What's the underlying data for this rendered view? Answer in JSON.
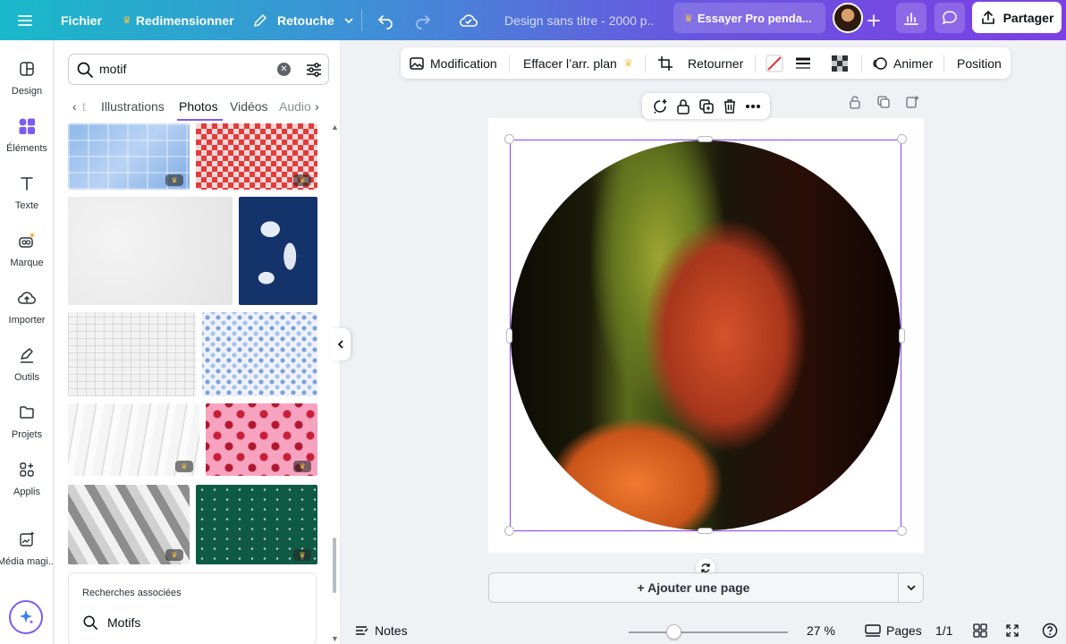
{
  "topbar": {
    "menu_label": "Fichier",
    "resize_label": "Redimensionner",
    "retouch_label": "Retouche",
    "doc_title": "Design sans titre - 2000 p...",
    "pro_label": "Essayer Pro penda...",
    "share_label": "Partager"
  },
  "rail": {
    "items": [
      {
        "label": "Design",
        "icon": "layout-icon"
      },
      {
        "label": "Éléments",
        "icon": "shapes-icon"
      },
      {
        "label": "Texte",
        "icon": "text-icon"
      },
      {
        "label": "Marque",
        "icon": "brand-icon"
      },
      {
        "label": "Importer",
        "icon": "upload-icon"
      },
      {
        "label": "Outils",
        "icon": "draw-icon"
      },
      {
        "label": "Projets",
        "icon": "folder-icon"
      },
      {
        "label": "Applis",
        "icon": "apps-icon"
      },
      {
        "label": "Média magi...",
        "icon": "magic-media-icon"
      }
    ]
  },
  "panel": {
    "search_value": "motif",
    "tabs": [
      "t",
      "Illustrations",
      "Photos",
      "Vidéos",
      "Audio"
    ],
    "active_tab": "Photos",
    "related_title": "Recherches associées",
    "related_item": "Motifs"
  },
  "context_toolbar": {
    "edit": "Modification",
    "remove_bg": "Effacer l’arr. plan",
    "flip": "Retourner",
    "animate": "Animer",
    "position": "Position"
  },
  "canvas": {
    "add_page_label": "+ Ajouter une page"
  },
  "bottom": {
    "notes": "Notes",
    "zoom": "27 %",
    "zoom_value_percent": 27,
    "pages_label": "Pages",
    "page_count": "1/1"
  },
  "colors": {
    "accent": "#8b3dff",
    "topbar_start": "#19b9c9",
    "topbar_end": "#7b3fe4"
  }
}
